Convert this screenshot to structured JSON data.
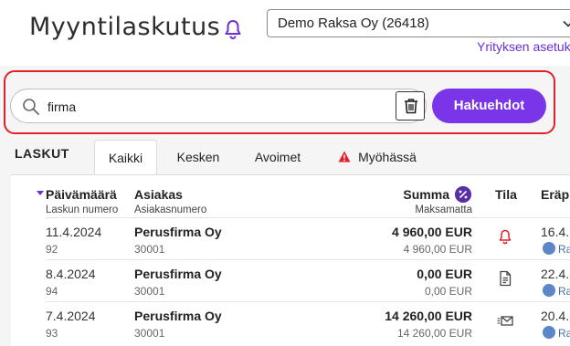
{
  "header": {
    "title": "Myyntilaskutus",
    "company_selected": "Demo Raksa Oy (26418)",
    "company_settings_link": "Yrityksen asetuk"
  },
  "search": {
    "value": "firma",
    "button_label": "Hakuehdot"
  },
  "invoices": {
    "section_label": "LASKUT",
    "tabs": [
      {
        "label": "Kaikki",
        "active": true
      },
      {
        "label": "Kesken",
        "active": false
      },
      {
        "label": "Avoimet",
        "active": false
      },
      {
        "label": "Myöhässä",
        "active": false,
        "icon": "warning-icon"
      }
    ],
    "columns": {
      "date": "Päivämäärä",
      "invoice_number": "Laskun numero",
      "customer": "Asiakas",
      "customer_number": "Asiakasnumero",
      "sum": "Summa",
      "unpaid": "Maksamatta",
      "state": "Tila",
      "due": "Eräp"
    },
    "rows": [
      {
        "date": "11.4.2024",
        "number": "92",
        "customer": "Perusfirma Oy",
        "customer_number": "30001",
        "sum": "4 960,00 EUR",
        "unpaid": "4 960,00 EUR",
        "state_icon": "bell-icon",
        "due": "16.4.",
        "badge": "Ra"
      },
      {
        "date": "8.4.2024",
        "number": "94",
        "customer": "Perusfirma Oy",
        "customer_number": "30001",
        "sum": "0,00 EUR",
        "unpaid": "0,00 EUR",
        "state_icon": "document-icon",
        "due": "22.4.",
        "badge": "Ra"
      },
      {
        "date": "7.4.2024",
        "number": "93",
        "customer": "Perusfirma Oy",
        "customer_number": "30001",
        "sum": "14 260,00 EUR",
        "unpaid": "14 260,00 EUR",
        "state_icon": "envelope-icon",
        "due": "20.4.",
        "badge": "Ra"
      }
    ]
  },
  "colors": {
    "accent": "#7a35e8",
    "link": "#6b2fd6",
    "highlight_frame": "#e0202a",
    "alert": "#e0202a"
  }
}
